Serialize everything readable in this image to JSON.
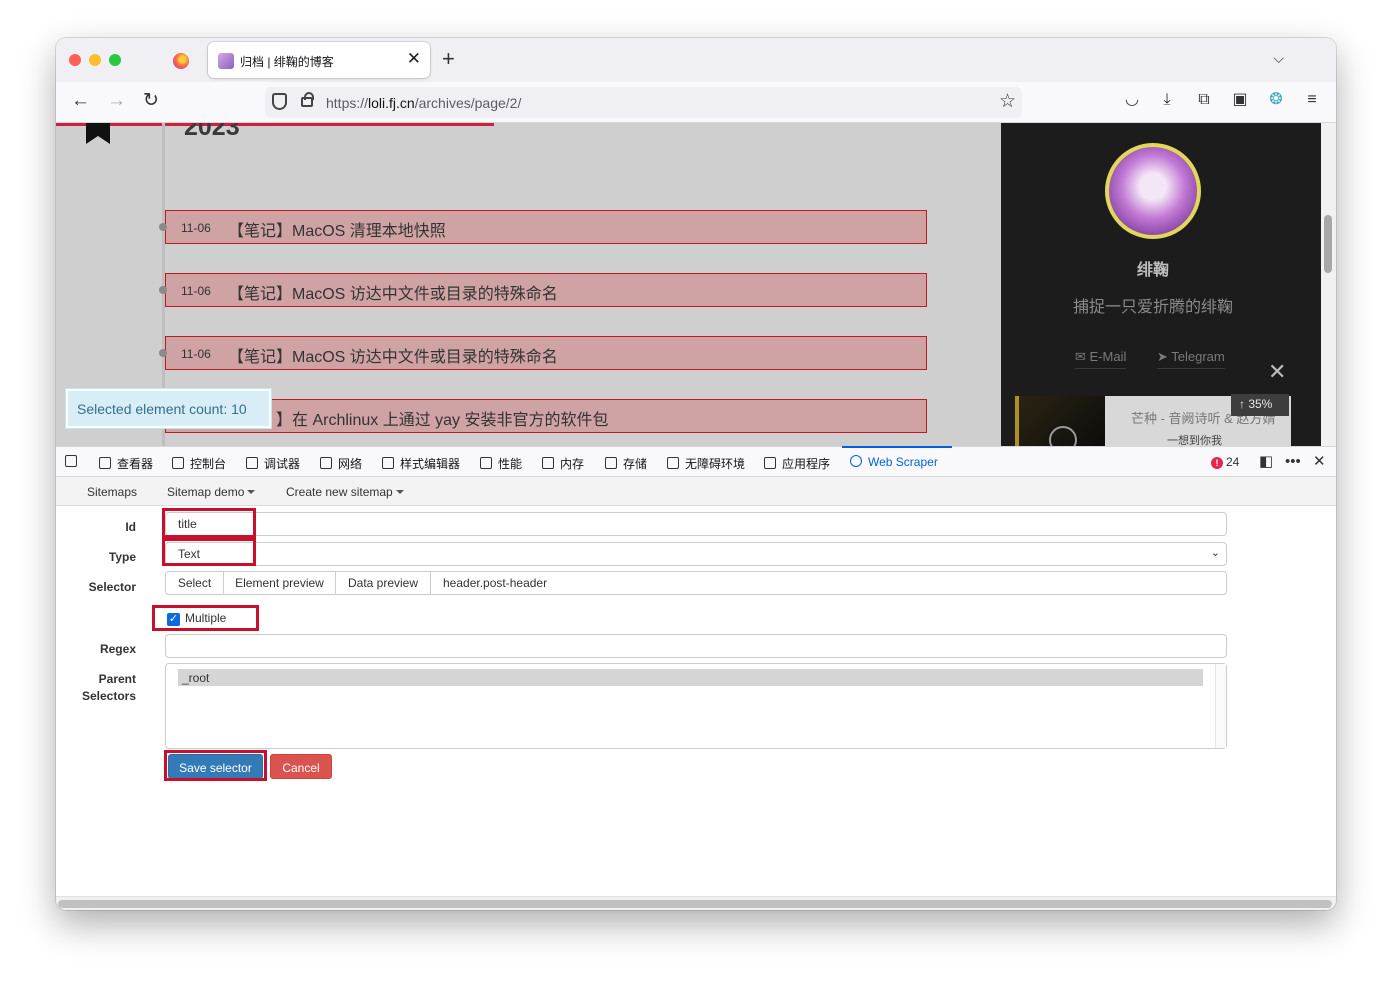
{
  "browser": {
    "tab_title": "归档 | 绯鞠的博客",
    "tab_close": "✕",
    "new_tab": "+",
    "tab_list": "⌵",
    "url_prefix": "https://",
    "url_host": "loli.fj.cn",
    "url_path": "/archives/page/2/"
  },
  "page": {
    "year": "2023",
    "posts": [
      {
        "date": "11-06",
        "title": "【笔记】MacOS 清理本地快照"
      },
      {
        "date": "11-06",
        "title": "【笔记】MacOS 访达中文件或目录的特殊命名"
      },
      {
        "date": "11-06",
        "title": "【笔记】MacOS 访达中文件或目录的特殊命名"
      },
      {
        "date": "",
        "title": "】在 Archlinux 上通过 yay 安装非官方的软件包"
      }
    ],
    "selected_count": "Selected element count: 10",
    "author_name": "绯鞠",
    "author_motto": "捕捉一只爱折腾的绯鞠",
    "social_email": "✉ E-Mail",
    "social_telegram": "➤ Telegram",
    "music_title": "芒种 - 音阙诗听 & 赵方婧",
    "music_lyric": "一想到你我",
    "scroll_percent": "↑ 35%"
  },
  "devtools": {
    "tabs": [
      "查看器",
      "控制台",
      "调试器",
      "网络",
      "样式编辑器",
      "性能",
      "内存",
      "存储",
      "无障碍环境",
      "应用程序",
      "Web Scraper"
    ],
    "error_count": "24"
  },
  "scraper": {
    "menu": {
      "sitemaps": "Sitemaps",
      "sitemap_demo": "Sitemap demo",
      "create": "Create new sitemap"
    },
    "labels": {
      "id": "Id",
      "type": "Type",
      "selector": "Selector",
      "regex": "Regex",
      "parent_1": "Parent",
      "parent_2": "Selectors"
    },
    "id_value": "title",
    "type_value": "Text",
    "selector_buttons": {
      "select": "Select",
      "element_preview": "Element preview",
      "data_preview": "Data preview"
    },
    "selector_value": "header.post-header",
    "multiple_label": "Multiple",
    "multiple_checked": true,
    "parent_options": [
      "_root"
    ],
    "save_label": "Save selector",
    "cancel_label": "Cancel"
  }
}
